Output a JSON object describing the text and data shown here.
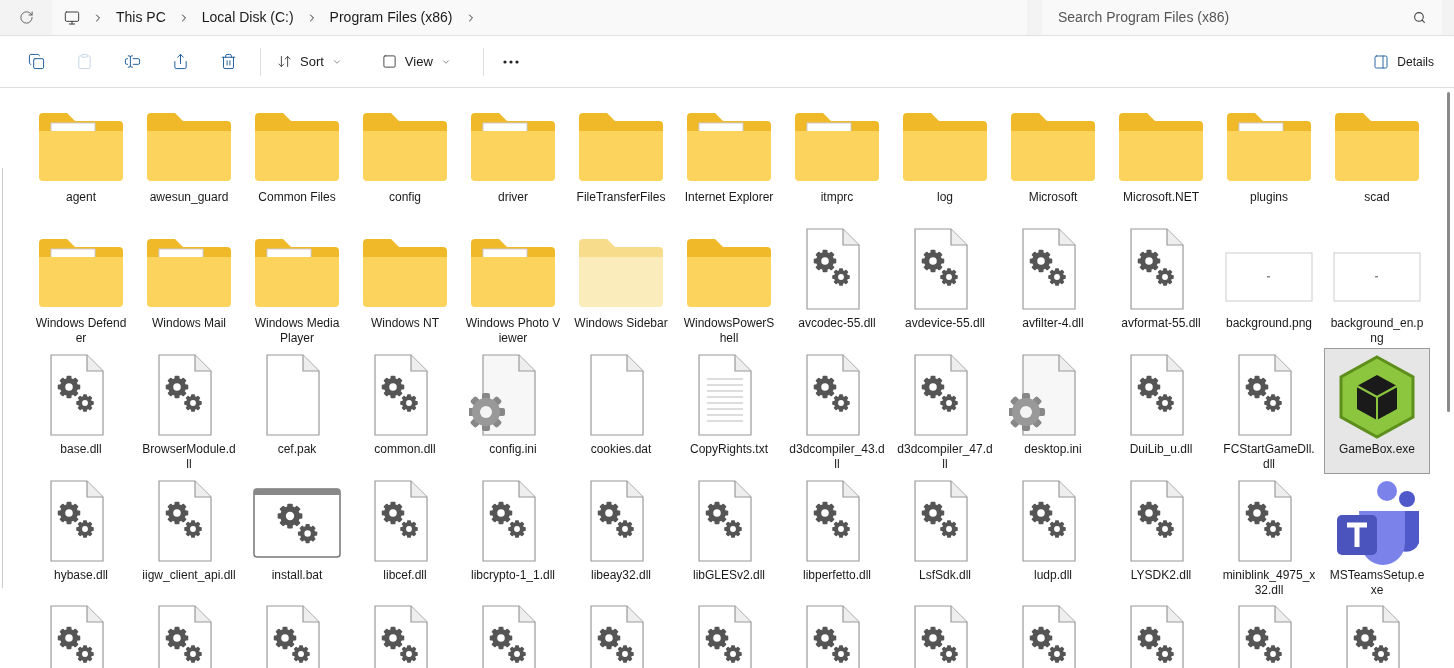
{
  "top_bar": {
    "breadcrumb": [
      "This PC",
      "Local Disk (C:)",
      "Program Files (x86)"
    ],
    "search": {
      "placeholder": "Search Program Files (x86)"
    }
  },
  "toolbar": {
    "icon_buttons": [
      {
        "kind": "copy",
        "disabled": false
      },
      {
        "kind": "paste",
        "disabled": true
      },
      {
        "kind": "rename",
        "disabled": false
      },
      {
        "kind": "share",
        "disabled": false
      },
      {
        "kind": "delete",
        "disabled": false
      }
    ],
    "menus": [
      {
        "kind": "sort",
        "label": "Sort"
      },
      {
        "kind": "view",
        "label": "View"
      }
    ],
    "details": "Details"
  },
  "items": [
    {
      "name": "agent",
      "kind": "folder-file",
      "selected": false
    },
    {
      "name": "awesun_guard",
      "kind": "folder",
      "selected": false
    },
    {
      "name": "Common Files",
      "kind": "folder",
      "selected": false
    },
    {
      "name": "config",
      "kind": "folder",
      "selected": false
    },
    {
      "name": "driver",
      "kind": "folder-file",
      "selected": false
    },
    {
      "name": "FileTransferFiles",
      "kind": "folder",
      "selected": false
    },
    {
      "name": "Internet Explorer",
      "kind": "folder-file",
      "selected": false
    },
    {
      "name": "itmprc",
      "kind": "folder-file",
      "selected": false
    },
    {
      "name": "log",
      "kind": "folder",
      "selected": false
    },
    {
      "name": "Microsoft",
      "kind": "folder",
      "selected": false
    },
    {
      "name": "Microsoft.NET",
      "kind": "folder",
      "selected": false
    },
    {
      "name": "plugins",
      "kind": "folder-file",
      "selected": false
    },
    {
      "name": "scad",
      "kind": "folder",
      "selected": false
    },
    {
      "name": "Windows Defender",
      "kind": "folder-file",
      "selected": false
    },
    {
      "name": "Windows Mail",
      "kind": "folder-file",
      "selected": false
    },
    {
      "name": "Windows Media Player",
      "kind": "folder-file",
      "selected": false
    },
    {
      "name": "Windows NT",
      "kind": "folder",
      "selected": false
    },
    {
      "name": "Windows Photo Viewer",
      "kind": "folder-file",
      "selected": false
    },
    {
      "name": "Windows Sidebar",
      "kind": "folder-faded",
      "selected": false
    },
    {
      "name": "WindowsPowerShell",
      "kind": "folder",
      "selected": false
    },
    {
      "name": "avcodec-55.dll",
      "kind": "dll",
      "selected": false
    },
    {
      "name": "avdevice-55.dll",
      "kind": "dll",
      "selected": false
    },
    {
      "name": "avfilter-4.dll",
      "kind": "dll",
      "selected": false
    },
    {
      "name": "avformat-55.dll",
      "kind": "dll",
      "selected": false
    },
    {
      "name": "background.png",
      "kind": "image",
      "selected": false
    },
    {
      "name": "background_en.png",
      "kind": "image",
      "selected": false
    },
    {
      "name": "base.dll",
      "kind": "dll",
      "selected": false
    },
    {
      "name": "BrowserModule.dll",
      "kind": "dll",
      "selected": false
    },
    {
      "name": "cef.pak",
      "kind": "blank",
      "selected": false
    },
    {
      "name": "common.dll",
      "kind": "dll",
      "selected": false
    },
    {
      "name": "config.ini",
      "kind": "ini",
      "selected": false
    },
    {
      "name": "cookies.dat",
      "kind": "blank",
      "selected": false
    },
    {
      "name": "CopyRights.txt",
      "kind": "text",
      "selected": false
    },
    {
      "name": "d3dcompiler_43.dll",
      "kind": "dll",
      "selected": false
    },
    {
      "name": "d3dcompiler_47.dll",
      "kind": "dll",
      "selected": false
    },
    {
      "name": "desktop.ini",
      "kind": "ini",
      "selected": false
    },
    {
      "name": "DuiLib_u.dll",
      "kind": "dll",
      "selected": false
    },
    {
      "name": "FCStartGameDll.dll",
      "kind": "dll",
      "selected": false
    },
    {
      "name": "GameBox.exe",
      "kind": "gamebox",
      "selected": true
    },
    {
      "name": "hybase.dll",
      "kind": "dll",
      "selected": false
    },
    {
      "name": "iigw_client_api.dll",
      "kind": "dll",
      "selected": false
    },
    {
      "name": "install.bat",
      "kind": "bat",
      "selected": false
    },
    {
      "name": "libcef.dll",
      "kind": "dll",
      "selected": false
    },
    {
      "name": "libcrypto-1_1.dll",
      "kind": "dll",
      "selected": false
    },
    {
      "name": "libeay32.dll",
      "kind": "dll",
      "selected": false
    },
    {
      "name": "libGLESv2.dll",
      "kind": "dll",
      "selected": false
    },
    {
      "name": "libperfetto.dll",
      "kind": "dll",
      "selected": false
    },
    {
      "name": "LsfSdk.dll",
      "kind": "dll",
      "selected": false
    },
    {
      "name": "ludp.dll",
      "kind": "dll",
      "selected": false
    },
    {
      "name": "LYSDK2.dll",
      "kind": "dll",
      "selected": false
    },
    {
      "name": "miniblink_4975_x32.dll",
      "kind": "dll",
      "selected": false
    },
    {
      "name": "MSTeamsSetup.exe",
      "kind": "teams",
      "selected": false
    }
  ],
  "partial_row": [
    {
      "kind": "dll"
    },
    {
      "kind": "dll"
    },
    {
      "kind": "dll"
    },
    {
      "kind": "dll"
    },
    {
      "kind": "dll"
    },
    {
      "kind": "dll"
    },
    {
      "kind": "dll"
    },
    {
      "kind": "dll"
    },
    {
      "kind": "dll"
    },
    {
      "kind": "dll"
    },
    {
      "kind": "dll"
    },
    {
      "kind": "dll"
    },
    {
      "kind": "dll"
    }
  ]
}
